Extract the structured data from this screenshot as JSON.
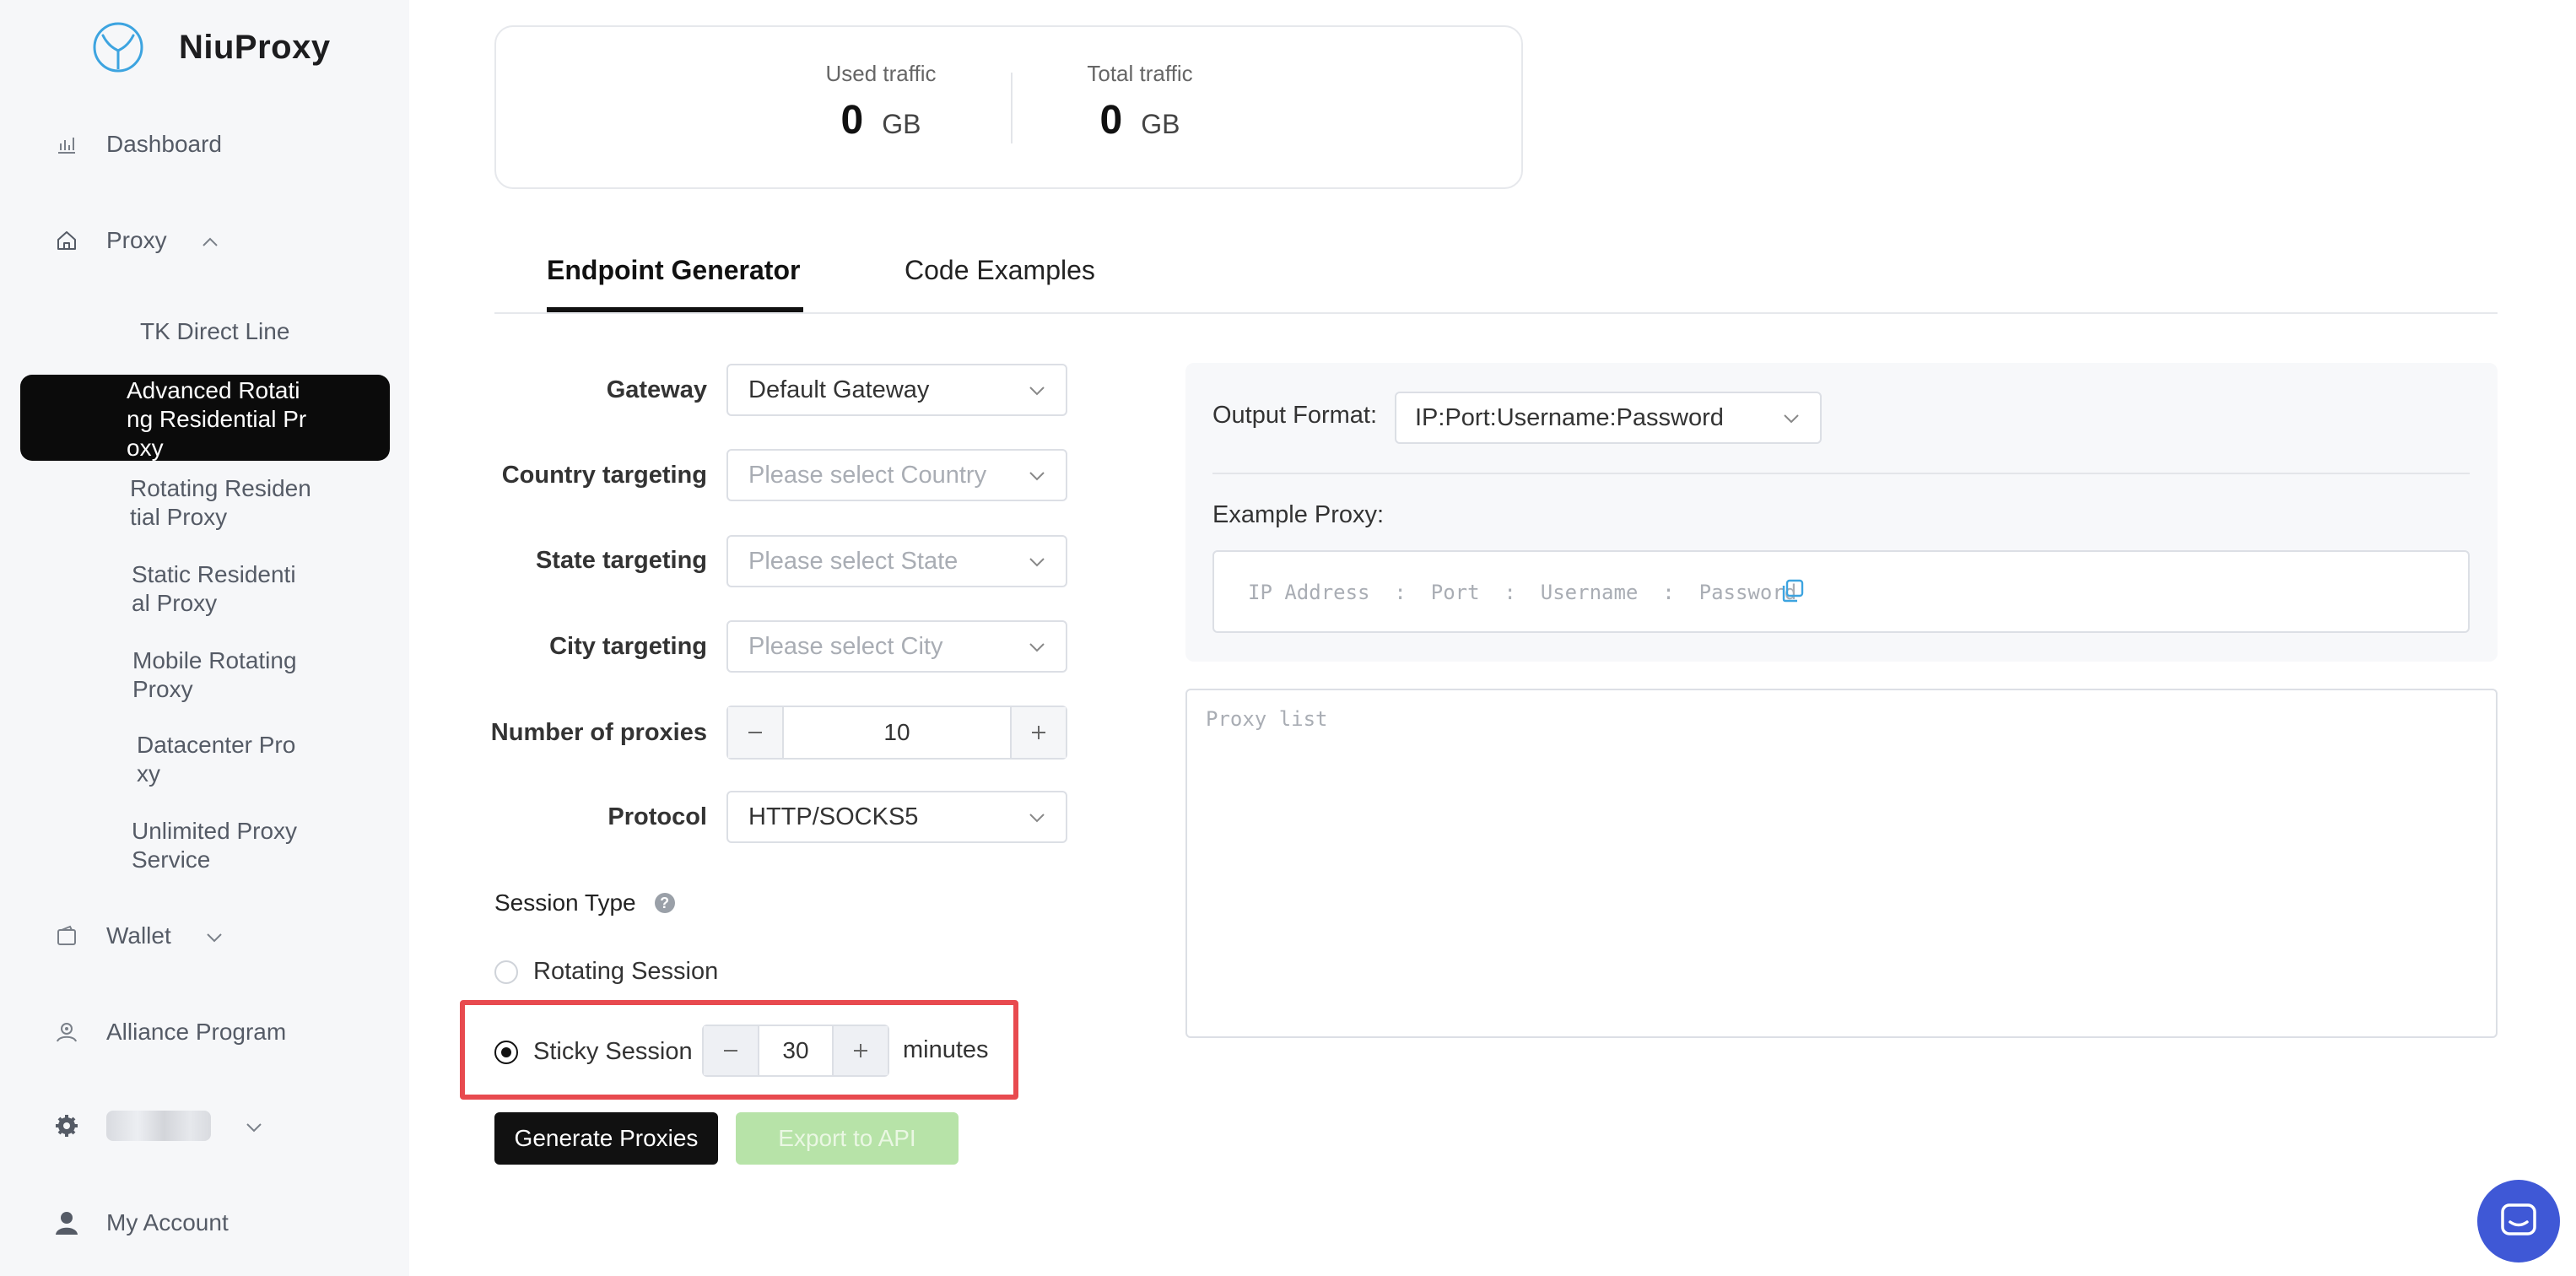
{
  "app": {
    "name": "NiuProxy"
  },
  "sidebar": {
    "dashboard": "Dashboard",
    "proxy": "Proxy",
    "proxy_sub": [
      "TK Direct Line",
      "Advanced Rotating Residential Proxy",
      "Rotating Residential Proxy",
      "Static Residential Proxy",
      "Mobile Rotating Proxy",
      "Datacenter Proxy",
      "Unlimited Proxy Service"
    ],
    "wallet": "Wallet",
    "alliance": "Alliance Program",
    "account": "My Account"
  },
  "traffic": {
    "used_label": "Used traffic",
    "used_value": "0",
    "used_unit": "GB",
    "total_label": "Total traffic",
    "total_value": "0",
    "total_unit": "GB"
  },
  "tabs": [
    "Endpoint Generator",
    "Code Examples"
  ],
  "form": {
    "gateway_label": "Gateway",
    "gateway_value": "Default Gateway",
    "country_label": "Country targeting",
    "country_placeholder": "Please select Country",
    "state_label": "State targeting",
    "state_placeholder": "Please select State",
    "city_label": "City targeting",
    "city_placeholder": "Please select City",
    "count_label": "Number of proxies",
    "count_value": "10",
    "protocol_label": "Protocol",
    "protocol_value": "HTTP/SOCKS5",
    "session_label": "Session Type",
    "rotating_label": "Rotating Session",
    "sticky_label": "Sticky Session",
    "sticky_value": "30",
    "sticky_unit": "minutes"
  },
  "buttons": {
    "generate": "Generate Proxies",
    "export": "Export to API"
  },
  "output": {
    "format_label": "Output Format:",
    "format_value": "IP:Port:Username:Password",
    "example_label": "Example Proxy:",
    "example_text": "IP Address  :  Port  :  Username  :  Password",
    "list_placeholder": "Proxy list"
  },
  "colors": {
    "accent": "#111111",
    "highlight": "#e84a4f",
    "export_disabled": "#b7e3a8",
    "chat": "#3f58d6",
    "logo": "#3da4e0"
  }
}
